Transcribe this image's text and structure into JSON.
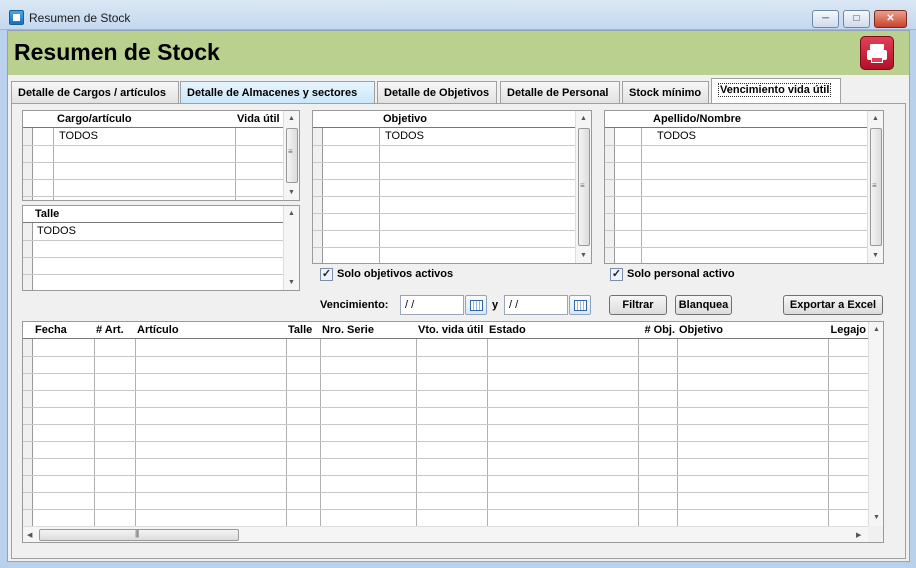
{
  "window": {
    "title": "Resumen de Stock",
    "min": "─",
    "max": "□",
    "close": "✕"
  },
  "header": {
    "title": "Resumen de Stock"
  },
  "tabs": [
    {
      "label": "Detalle de Cargos / artículos"
    },
    {
      "label": "Detalle de Almacenes y sectores"
    },
    {
      "label": "Detalle de Objetivos"
    },
    {
      "label": "Detalle de Personal"
    },
    {
      "label": "Stock mínimo"
    },
    {
      "label": "Vencimiento vida útil"
    }
  ],
  "cargo_grid": {
    "col1": "Cargo/artículo",
    "col2": "Vida útil",
    "rows": [
      "TODOS"
    ]
  },
  "talle_grid": {
    "col1": "Talle",
    "rows": [
      "TODOS"
    ]
  },
  "objetivo_grid": {
    "col1": "Objetivo",
    "rows": [
      "TODOS"
    ]
  },
  "personal_grid": {
    "col1": "Apellido/Nombre",
    "rows": [
      "TODOS"
    ]
  },
  "filters": {
    "solo_objetivos": "Solo objetivos activos",
    "solo_personal": "Solo personal activo",
    "vencimiento_label": "Vencimiento:",
    "date_from": " / /",
    "and_label": "y",
    "date_to": " / /",
    "filtrar": "Filtrar",
    "blanquea": "Blanquea",
    "exportar": "Exportar a Excel"
  },
  "results_grid": {
    "columns": [
      "Fecha",
      "# Art.",
      "Artículo",
      "Talle",
      "Nro. Serie",
      "Vto. vida útil",
      "Estado",
      "# Obj.",
      "Objetivo",
      "Legajo"
    ]
  }
}
